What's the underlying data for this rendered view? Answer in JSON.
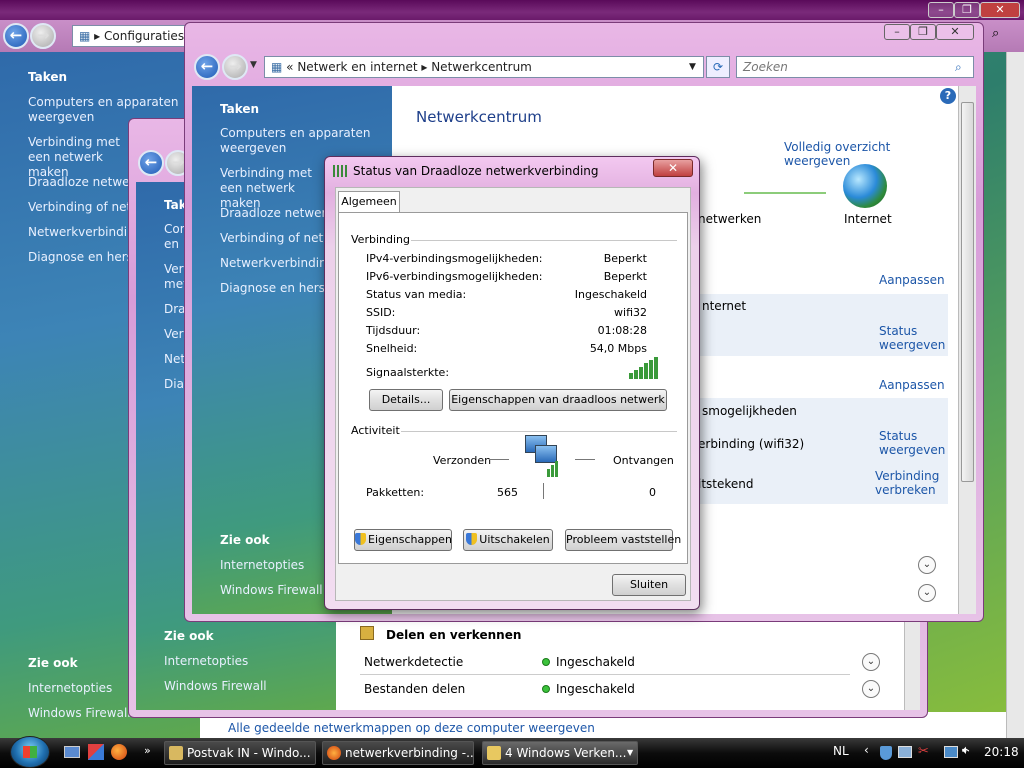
{
  "window_back": {
    "title_frag": "Configuraties",
    "sidebar": {
      "tasks_title": "Taken",
      "tasks": [
        "Computers en apparaten weergeven",
        "Verbinding met een netwerk maken",
        "Draadloze netwerken beheren",
        "Verbinding of netwerk instellen",
        "Netwerkverbindingen beheren",
        "Diagnose en herstel"
      ],
      "see_also_title": "Zie ook",
      "see_also": [
        "Internetopties",
        "Windows Firewall"
      ]
    },
    "footer_link": "Alle gedeelde netwerkmappen op deze computer weergeven"
  },
  "window_mid": {
    "sidebar": {
      "tasks_title": "Taken",
      "tasks": [
        "Computers en apparaten weergeven",
        "Verbinding met een netwerk maken",
        "Draadloze netwerken beheren",
        "Verbinding of netwerk instellen",
        "Netwerkverbindingen beheren",
        "Diagnose en herstel"
      ],
      "see_also_title": "Zie ook",
      "see_also": [
        "Internetopties",
        "Windows Firewall"
      ]
    },
    "sharing": {
      "title": "Delen en verkennen",
      "rows": [
        {
          "label": "Netwerkdetectie",
          "value": "Ingeschakeld"
        },
        {
          "label": "Bestanden delen",
          "value": "Ingeschakeld"
        }
      ]
    }
  },
  "window_front": {
    "breadcrumb": [
      "Netwerk en internet",
      "Netwerkcentrum"
    ],
    "search_placeholder": "Zoeken",
    "sidebar": {
      "tasks_title": "Taken",
      "tasks": [
        "Computers en apparaten weergeven",
        "Verbinding met een netwerk maken",
        "Draadloze netwerken beheren",
        "Verbinding of netwerk instellen",
        "Netwerkverbindingen beheren",
        "Diagnose en herstel"
      ],
      "see_also_title": "Zie ook",
      "see_also": [
        "Internetopties",
        "Windows Firewall"
      ]
    },
    "main": {
      "title": "Netwerkcentrum",
      "full_map": "Volledig overzicht weergeven",
      "map_network": "netwerken",
      "map_internet": "Internet",
      "customize1": "Aanpassen",
      "access_frag": "nternet",
      "status_link1": "Status weergeven",
      "customize2": "Aanpassen",
      "possibilities_frag": "smogelijkheden",
      "connection_frag": "erbinding (wifi32)",
      "status_link2": "Status weergeven",
      "disconnected_frag": "itstekend",
      "disconnect_link": "Verbinding verbreken"
    }
  },
  "dialog": {
    "title": "Status van Draadloze netwerkverbinding",
    "tab": "Algemeen",
    "connection_header": "Verbinding",
    "rows": [
      {
        "label": "IPv4-verbindingsmogelijkheden:",
        "value": "Beperkt"
      },
      {
        "label": "IPv6-verbindingsmogelijkheden:",
        "value": "Beperkt"
      },
      {
        "label": "Status van media:",
        "value": "Ingeschakeld"
      },
      {
        "label": "SSID:",
        "value": "wifi32"
      },
      {
        "label": "Tijdsduur:",
        "value": "01:08:28"
      },
      {
        "label": "Snelheid:",
        "value": "54,0 Mbps"
      }
    ],
    "signal_label": "Signaalsterkte:",
    "details_btn": "Details...",
    "wireless_props_btn": "Eigenschappen van draadloos netwerk",
    "activity_header": "Activiteit",
    "sent_label": "Verzonden",
    "received_label": "Ontvangen",
    "packets_label": "Pakketten:",
    "packets_sent": "565",
    "packets_received": "0",
    "properties_btn": "Eigenschappen",
    "disable_btn": "Uitschakelen",
    "diagnose_btn": "Probleem vaststellen",
    "close_btn": "Sluiten"
  },
  "taskbar": {
    "items": [
      "Postvak IN - Windo...",
      "netwerkverbinding -...",
      "4 Windows Verken..."
    ],
    "language": "NL",
    "clock": "20:18"
  }
}
